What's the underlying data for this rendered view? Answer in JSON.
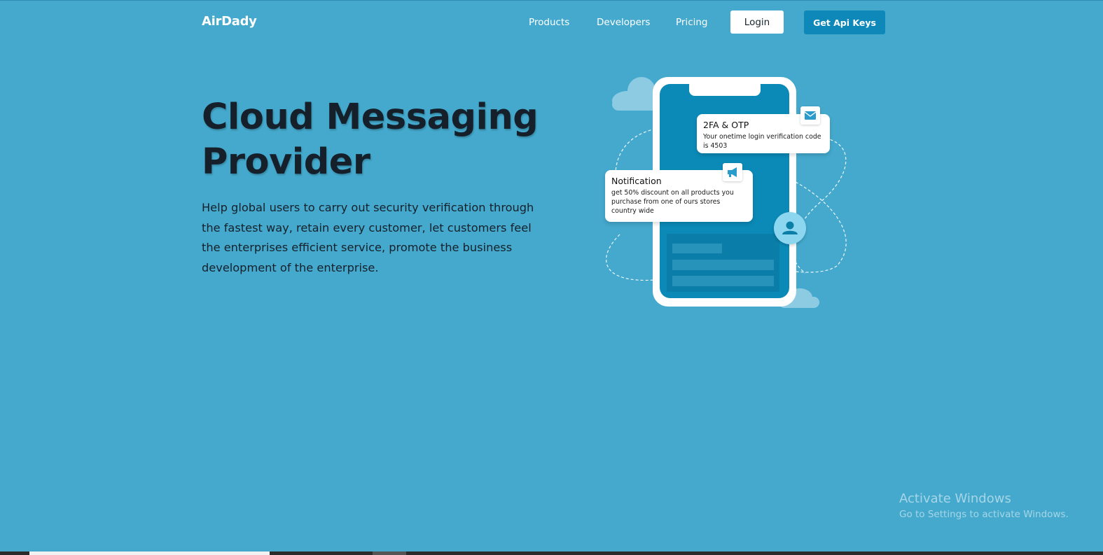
{
  "nav": {
    "brand": "AirDady",
    "links": [
      "Products",
      "Developers",
      "Pricing"
    ],
    "login_label": "Login",
    "api_keys_label": "Get Api Keys"
  },
  "hero": {
    "title": "Cloud Messaging Provider",
    "description": "Help global users to carry out security verification through the fastest way, retain every customer, let customers feel the enterprises efficient service, promote the business development of the enterprise."
  },
  "illustration": {
    "otp_card": {
      "title": "2FA & OTP",
      "body": "Your onetime login verification code is 4503",
      "icon": "envelope-icon"
    },
    "notification_card": {
      "title": "Notification",
      "body": "get 50% discount on all products you purchase from one of ours stores country wide",
      "icon": "megaphone-icon"
    },
    "avatar_icon": "user-icon"
  },
  "colors": {
    "background": "#44a9cd",
    "accent": "#0e88b8",
    "phone_screen": "#0b8ab7",
    "title_text": "#15202a"
  },
  "watermark": {
    "title": "Activate Windows",
    "subtitle": "Go to Settings to activate Windows."
  }
}
